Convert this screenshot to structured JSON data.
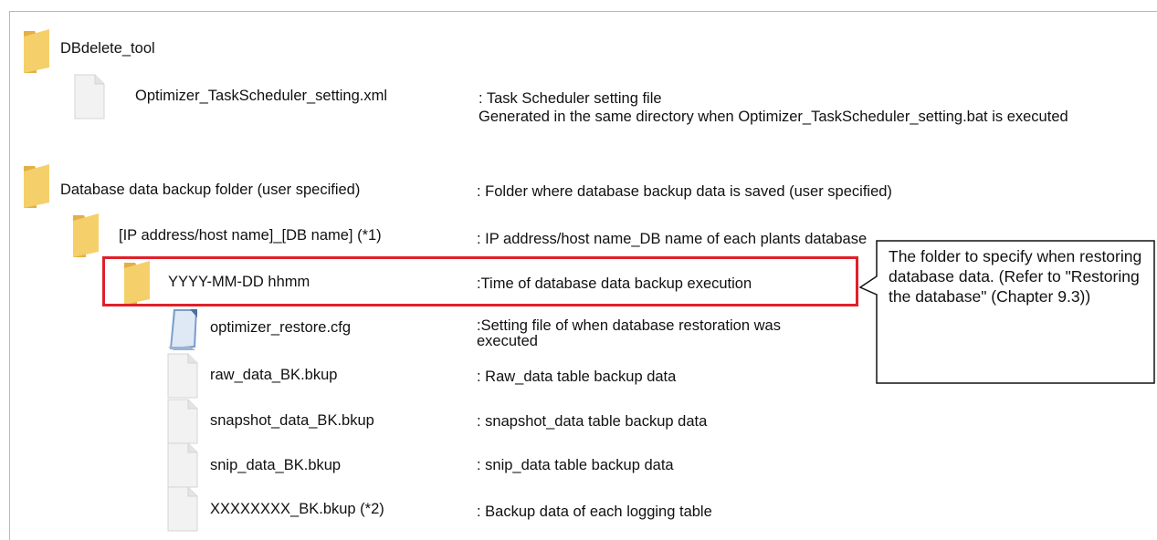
{
  "tree": [
    {
      "key": "dbdelete",
      "icon": "folder-icon",
      "name": "DBdelete_tool",
      "description": ""
    },
    {
      "key": "setting_xml",
      "icon": "file-icon",
      "name": "Optimizer_TaskScheduler_setting.xml",
      "description": ": Task Scheduler setting file\nGenerated in the same directory when Optimizer_TaskScheduler_setting.bat is executed"
    },
    {
      "key": "backup_folder",
      "icon": "folder-icon",
      "name": "Database data backup folder (user specified)",
      "description": ": Folder where database backup data is saved (user specified)"
    },
    {
      "key": "ip_folder",
      "icon": "folder-icon",
      "name": "[IP address/host name]_[DB name] (*1)",
      "description": ": IP address/host name_DB name of each plants database"
    },
    {
      "key": "date_folder",
      "icon": "folder-icon",
      "name": "YYYY-MM-DD hhmm",
      "description": ":Time of database data backup execution"
    },
    {
      "key": "restore_cfg",
      "icon": "notepad-icon",
      "name": "optimizer_restore.cfg",
      "description": ":Setting file of when database restoration was executed"
    },
    {
      "key": "raw_data",
      "icon": "file-icon",
      "name": "raw_data_BK.bkup",
      "description": ": Raw_data table backup data"
    },
    {
      "key": "snapshot_data",
      "icon": "file-icon",
      "name": "snapshot_data_BK.bkup",
      "description": ": snapshot_data table backup data"
    },
    {
      "key": "snip_data",
      "icon": "file-icon",
      "name": "snip_data_BK.bkup",
      "description": ": snip_data table backup data"
    },
    {
      "key": "logging_data",
      "icon": "file-icon",
      "name": "XXXXXXXX_BK.bkup (*2)",
      "description": ": Backup data of each logging table"
    }
  ],
  "callout": {
    "text": "The folder to specify when restoring database data. (Refer to \"Restoring the database\" (Chapter 9.3))"
  },
  "colors": {
    "highlight": "#e0202a",
    "folder": "#f5cf6a",
    "folder_dark": "#e2b044",
    "file": "#f2f2f2"
  }
}
